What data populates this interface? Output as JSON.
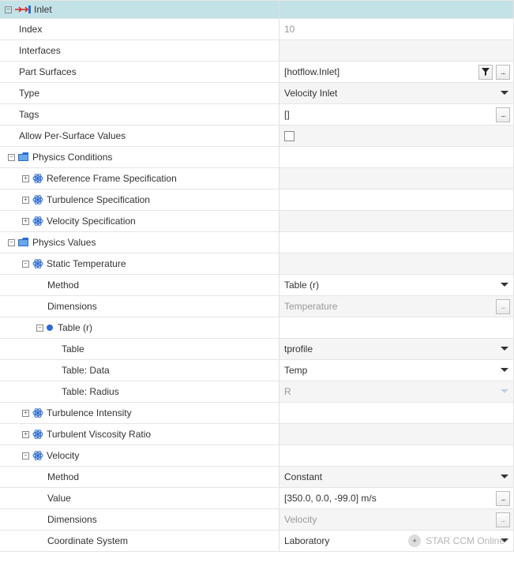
{
  "header": {
    "title": "Inlet"
  },
  "props": {
    "index_label": "Index",
    "index_value": "10",
    "interfaces_label": "Interfaces",
    "partsurfaces_label": "Part Surfaces",
    "partsurfaces_value": "[hotflow.Inlet]",
    "type_label": "Type",
    "type_value": "Velocity Inlet",
    "tags_label": "Tags",
    "tags_value": "[]",
    "allowps_label": "Allow Per-Surface Values"
  },
  "phys_cond": {
    "title": "Physics Conditions",
    "items": {
      "ref_frame": "Reference Frame Specification",
      "turb_spec": "Turbulence Specification",
      "vel_spec": "Velocity Specification"
    }
  },
  "phys_val": {
    "title": "Physics Values",
    "static_temp": {
      "title": "Static Temperature",
      "method_label": "Method",
      "method_value": "Table (r)",
      "dimensions_label": "Dimensions",
      "dimensions_value": "Temperature",
      "table_r": {
        "title": "Table (r)",
        "table_label": "Table",
        "table_value": "tprofile",
        "data_label": "Table: Data",
        "data_value": "Temp",
        "radius_label": "Table: Radius",
        "radius_value": "R"
      }
    },
    "turb_intensity": "Turbulence Intensity",
    "turb_visc_ratio": "Turbulent Viscosity Ratio",
    "velocity": {
      "title": "Velocity",
      "method_label": "Method",
      "method_value": "Constant",
      "value_label": "Value",
      "value_value": "[350.0, 0.0, -99.0] m/s",
      "dimensions_label": "Dimensions",
      "dimensions_value": "Velocity",
      "coord_label": "Coordinate System",
      "coord_value": "Laboratory"
    }
  },
  "watermark": "STAR CCM Online"
}
